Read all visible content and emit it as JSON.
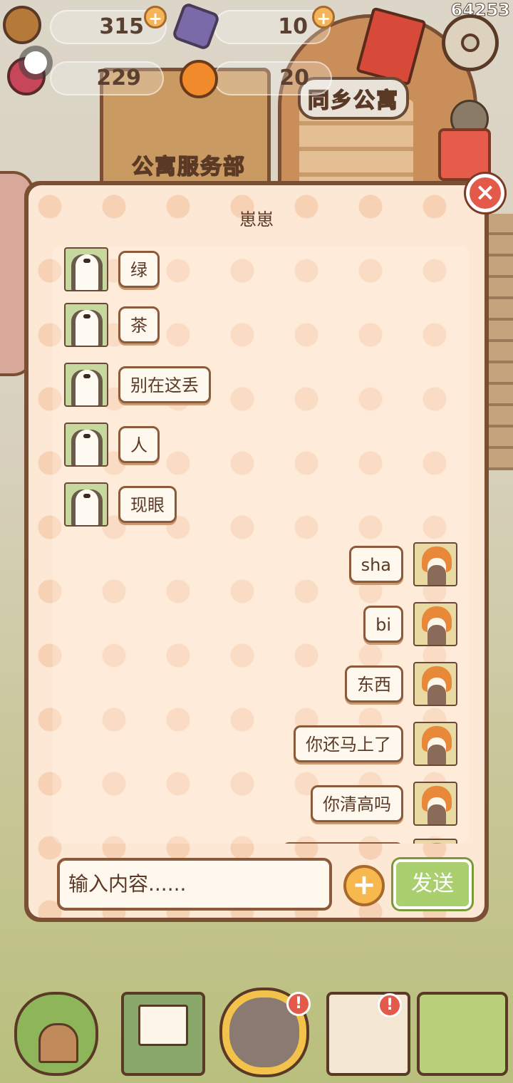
{
  "status": {
    "counter": "64253"
  },
  "resources": [
    {
      "icon": "acorn-icon",
      "value": "315",
      "has_plus": true
    },
    {
      "icon": "crystal-icon",
      "value": "10",
      "has_plus": true
    },
    {
      "icon": "heart-gem-icon",
      "value": "229",
      "has_plus": false
    },
    {
      "icon": "orange-icon",
      "value": "20",
      "has_plus": false
    }
  ],
  "scene": {
    "left_sign": "公寓服务部",
    "right_sign": "同乡公寓"
  },
  "chat": {
    "title": "崽崽",
    "close_icon": "×",
    "messages": [
      {
        "side": "left",
        "avatar": "otter-avatar",
        "text": "绿"
      },
      {
        "side": "left",
        "avatar": "otter-avatar",
        "text": "茶"
      },
      {
        "side": "left",
        "avatar": "otter-avatar",
        "text": "别在这丢"
      },
      {
        "side": "left",
        "avatar": "otter-avatar",
        "text": "人"
      },
      {
        "side": "left",
        "avatar": "otter-avatar",
        "text": "现眼"
      },
      {
        "side": "right",
        "avatar": "fox-otter-avatar",
        "text": "sha"
      },
      {
        "side": "right",
        "avatar": "fox-otter-avatar",
        "text": "bi"
      },
      {
        "side": "right",
        "avatar": "fox-otter-avatar",
        "text": "东西"
      },
      {
        "side": "right",
        "avatar": "fox-otter-avatar",
        "text": "你还马上了"
      },
      {
        "side": "right",
        "avatar": "fox-otter-avatar",
        "text": "你清高吗"
      }
    ],
    "input": {
      "placeholder": "输入内容......"
    },
    "add_label": "+",
    "send_label": "发送"
  },
  "nav": {
    "items": [
      {
        "name": "home-icon",
        "alert": false
      },
      {
        "name": "mail-icon",
        "alert": false
      },
      {
        "name": "friends-icon",
        "alert": true
      },
      {
        "name": "tasks-icon",
        "alert": true
      },
      {
        "name": "map-icon",
        "alert": false
      }
    ],
    "alert_label": "!"
  }
}
